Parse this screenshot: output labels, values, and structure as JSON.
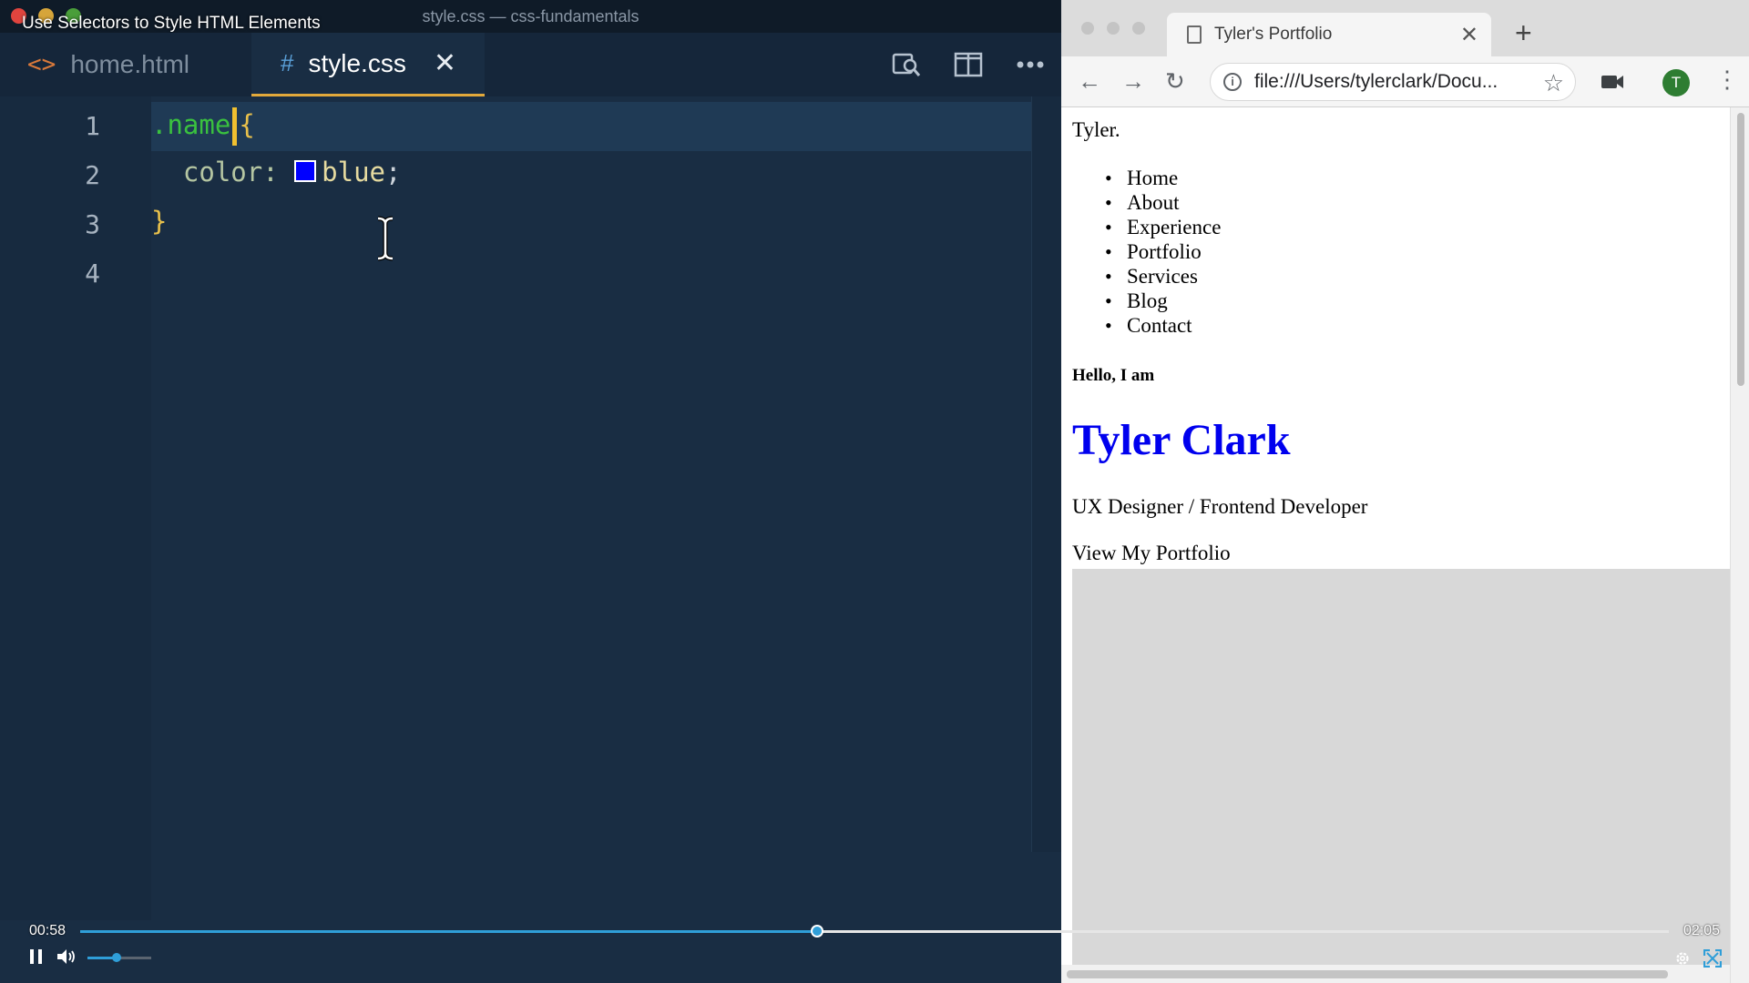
{
  "video": {
    "title": "Use Selectors to Style HTML Elements",
    "current_time": "00:58",
    "duration": "02:05",
    "progress": 0.464,
    "volume": 0.45
  },
  "editor": {
    "window_title": "style.css — css-fundamentals",
    "tabs": [
      {
        "label": "home.html",
        "icon": "html-file-icon",
        "active": false
      },
      {
        "label": "style.css",
        "icon": "hash-css-icon",
        "active": true
      }
    ],
    "line_numbers": [
      "1",
      "2",
      "3",
      "4"
    ],
    "code": {
      "line1_selector": ".name",
      "line1_brace": "{",
      "line2_property": "color:",
      "line2_value": "blue",
      "line2_semicolon": ";",
      "line3_brace": "}"
    },
    "swatch_color": "#0000ff"
  },
  "browser": {
    "tab_title": "Tyler's Portfolio",
    "url": "file:///Users/tylerclark/Docu...",
    "avatar_letter": "T",
    "page": {
      "logo": "Tyler.",
      "nav": [
        "Home",
        "About",
        "Experience",
        "Portfolio",
        "Services",
        "Blog",
        "Contact"
      ],
      "hello": "Hello, I am",
      "name": "Tyler Clark",
      "role": "UX Designer / Frontend Developer",
      "cta": "View My Portfolio"
    }
  }
}
